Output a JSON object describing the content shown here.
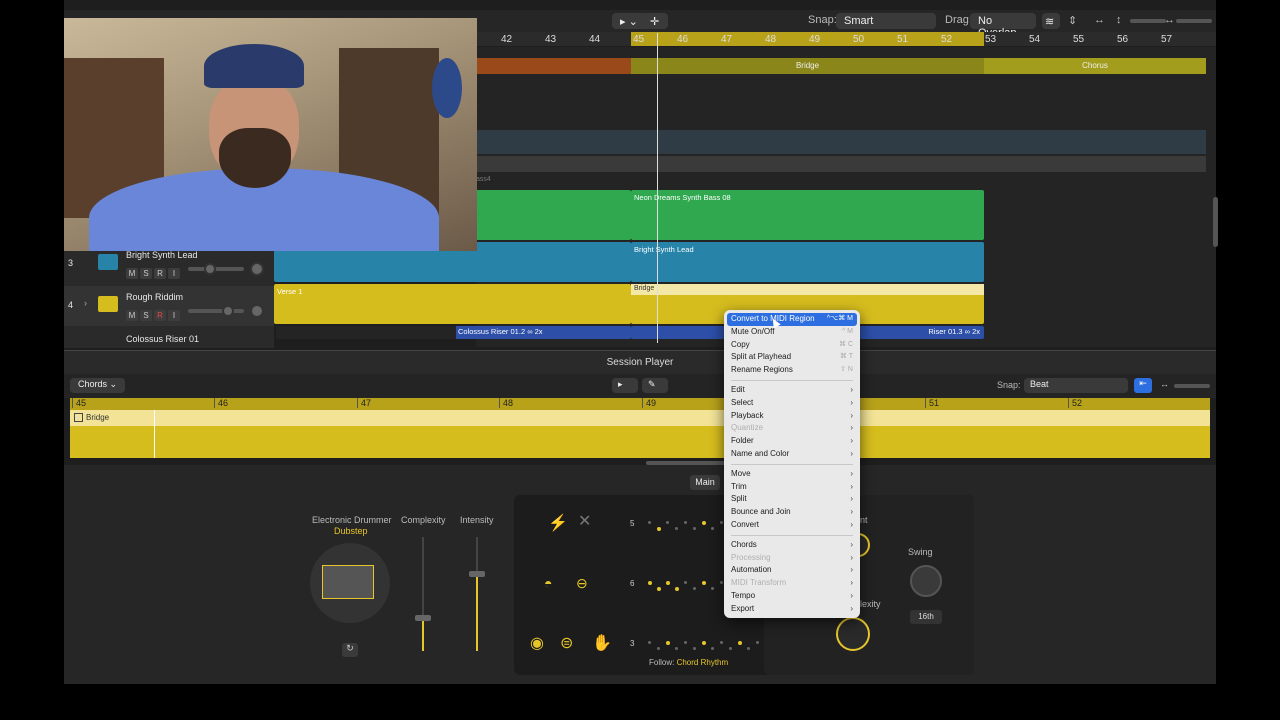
{
  "toolbar": {
    "snap_label": "Snap:",
    "snap_value": "Smart",
    "drag_label": "Drag:",
    "drag_value": "No Overlap"
  },
  "ruler": {
    "bars": [
      "42",
      "43",
      "44",
      "45",
      "46",
      "47",
      "48",
      "49",
      "50",
      "51",
      "52",
      "53",
      "54",
      "55",
      "56",
      "57"
    ]
  },
  "arranger": {
    "markers": [
      {
        "label": "Bridge",
        "color": "#8a861a"
      },
      {
        "label": "Chorus",
        "color": "#a39d1d"
      }
    ],
    "regions": {
      "synth_bass": "Neon Dreams Synth Bass 08",
      "synth_lead": "Bright Synth Lead",
      "verse": "Verse 1",
      "bridge": "Bridge",
      "riser_a": "Colossus Riser 01.2",
      "riser_a_loop": "2x",
      "riser_b": "Riser 01.3",
      "riser_b_loop": "2x",
      "faint": "ass4"
    }
  },
  "tracks": [
    {
      "number": "3",
      "name": "Bright Synth Lead",
      "buttons": [
        "M",
        "S",
        "R",
        "I"
      ]
    },
    {
      "number": "4",
      "name": "Rough Riddim",
      "buttons": [
        "M",
        "S",
        "R",
        "I"
      ]
    },
    {
      "number": "",
      "name": "Colossus Riser 01",
      "buttons": []
    }
  ],
  "session_player": {
    "title": "Session Player",
    "chords_button": "Chords",
    "snap_label": "Snap:",
    "snap_value": "Beat",
    "ruler": [
      "45",
      "46",
      "47",
      "48",
      "49",
      "51",
      "52"
    ],
    "region_label": "Bridge"
  },
  "drummer": {
    "main_tab": "Main",
    "kit_label": "Electronic Drummer",
    "kit_style": "Dubstep",
    "complexity_label": "Complexity",
    "intensity_label": "Intensity",
    "follow_label": "Follow:",
    "follow_value": "Chord Rhythm",
    "row_numbers": [
      "5",
      "6",
      "3"
    ],
    "swing_label": "Swing",
    "swing_value": "16th",
    "partial_label_1": "nt",
    "partial_label_2": "lexity"
  },
  "context_menu": {
    "items": [
      {
        "label": "Convert to MIDI Region",
        "shortcut": "^⌥⌘ M",
        "state": "highlighted"
      },
      {
        "label": "Mute On/Off",
        "shortcut": "^ M",
        "state": "normal"
      },
      {
        "label": "Copy",
        "shortcut": "⌘ C",
        "state": "normal"
      },
      {
        "label": "Split at Playhead",
        "shortcut": "⌘ T",
        "state": "normal"
      },
      {
        "label": "Rename Regions",
        "shortcut": "⇧ N",
        "state": "normal"
      },
      {
        "separator": true
      },
      {
        "label": "Edit",
        "submenu": true
      },
      {
        "label": "Select",
        "submenu": true
      },
      {
        "label": "Playback",
        "submenu": true
      },
      {
        "label": "Quantize",
        "submenu": true,
        "state": "disabled"
      },
      {
        "label": "Folder",
        "submenu": true
      },
      {
        "label": "Name and Color",
        "submenu": true
      },
      {
        "separator": true
      },
      {
        "label": "Move",
        "submenu": true
      },
      {
        "label": "Trim",
        "submenu": true
      },
      {
        "label": "Split",
        "submenu": true
      },
      {
        "label": "Bounce and Join",
        "submenu": true
      },
      {
        "label": "Convert",
        "submenu": true
      },
      {
        "separator": true
      },
      {
        "label": "Chords",
        "submenu": true
      },
      {
        "label": "Processing",
        "submenu": true,
        "state": "disabled"
      },
      {
        "label": "Automation",
        "submenu": true
      },
      {
        "label": "MIDI Transform",
        "submenu": true,
        "state": "disabled"
      },
      {
        "label": "Tempo",
        "submenu": true
      },
      {
        "label": "Export",
        "submenu": true
      }
    ]
  },
  "colors": {
    "accent_yellow": "#e7c62a",
    "region_green": "#2fa84f",
    "region_teal": "#2784a8",
    "region_gold": "#d6bd1e",
    "menu_highlight": "#2d6fe0"
  }
}
